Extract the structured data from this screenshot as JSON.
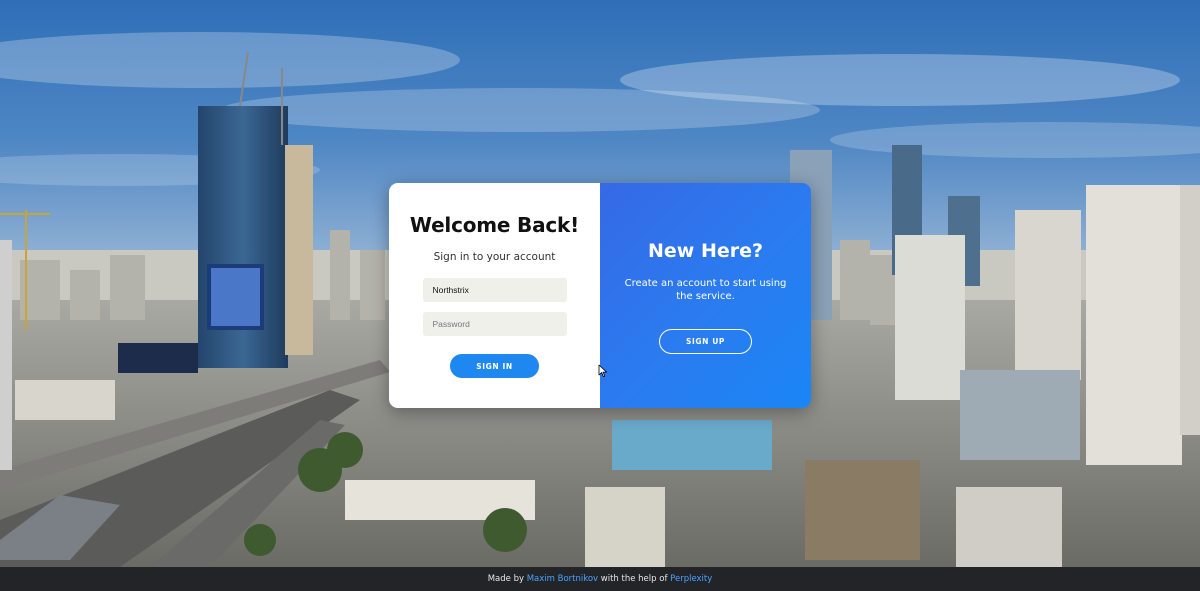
{
  "login": {
    "title": "Welcome Back!",
    "subtitle": "Sign in to your account",
    "username_value": "Northstrix",
    "password_placeholder": "Password",
    "signin_label": "SIGN IN"
  },
  "signup": {
    "title": "New Here?",
    "description": "Create an account to start using the service.",
    "signup_label": "SIGN UP"
  },
  "footer": {
    "made_by_text": "Made by ",
    "author_name": "Maxim Bortnikov",
    "middle_text": " with the help of ",
    "helper_name": "Perplexity"
  },
  "colors": {
    "accent": "#1e88f0",
    "gradient_start": "#3669e6",
    "gradient_end": "#1a86f5",
    "footer_bg": "#222428",
    "footer_link": "#4aa3ff"
  },
  "icons": {
    "cursor": "mouse-pointer-icon"
  }
}
